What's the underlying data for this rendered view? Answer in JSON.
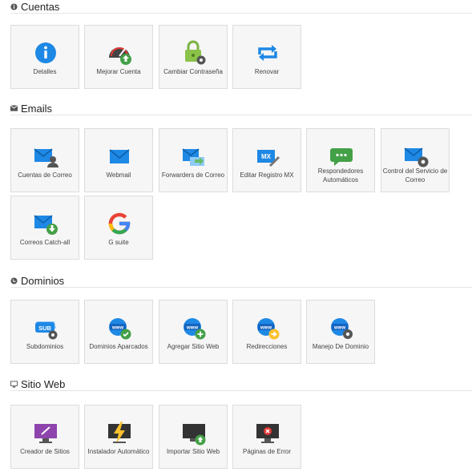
{
  "sections": [
    {
      "title": "Cuentas",
      "icon": "info-circle-icon",
      "items": [
        {
          "label": "Detalles",
          "icon": "info-icon"
        },
        {
          "label": "Mejorar Cuenta",
          "icon": "speedometer-upgrade-icon"
        },
        {
          "label": "Cambiar Contraseña",
          "icon": "lock-gear-icon"
        },
        {
          "label": "Renovar",
          "icon": "renew-arrows-icon"
        }
      ]
    },
    {
      "title": "Emails",
      "icon": "envelope-icon",
      "items": [
        {
          "label": "Cuentas de Correo",
          "icon": "mail-user-icon"
        },
        {
          "label": "Webmail",
          "icon": "mail-icon"
        },
        {
          "label": "Forwarders de Correo",
          "icon": "mail-forward-icon"
        },
        {
          "label": "Editar Registro MX",
          "icon": "mx-record-icon"
        },
        {
          "label": "Respondedores Automáticos",
          "icon": "autoresponder-icon"
        },
        {
          "label": "Control del Servicio de Correo",
          "icon": "mail-gear-icon"
        },
        {
          "label": "Correos Catch-all",
          "icon": "mail-download-icon"
        },
        {
          "label": "G suite",
          "icon": "google-g-icon"
        }
      ]
    },
    {
      "title": "Dominios",
      "icon": "globe-icon",
      "items": [
        {
          "label": "Subdominios",
          "icon": "subdomain-gear-icon"
        },
        {
          "label": "Dominios Aparcados",
          "icon": "www-check-icon"
        },
        {
          "label": "Agregar Sitio Web",
          "icon": "www-add-icon"
        },
        {
          "label": "Redirecciones",
          "icon": "www-redirect-icon"
        },
        {
          "label": "Manejo De Dominio",
          "icon": "www-gear-icon"
        }
      ]
    },
    {
      "title": "Sitio Web",
      "icon": "monitor-icon",
      "items": [
        {
          "label": "Creador de Sitios",
          "icon": "site-builder-icon"
        },
        {
          "label": "Instalador Automático",
          "icon": "auto-installer-icon"
        },
        {
          "label": "Importar Sitio Web",
          "icon": "import-site-icon"
        },
        {
          "label": "Páginas de Error",
          "icon": "error-pages-icon"
        }
      ]
    }
  ]
}
